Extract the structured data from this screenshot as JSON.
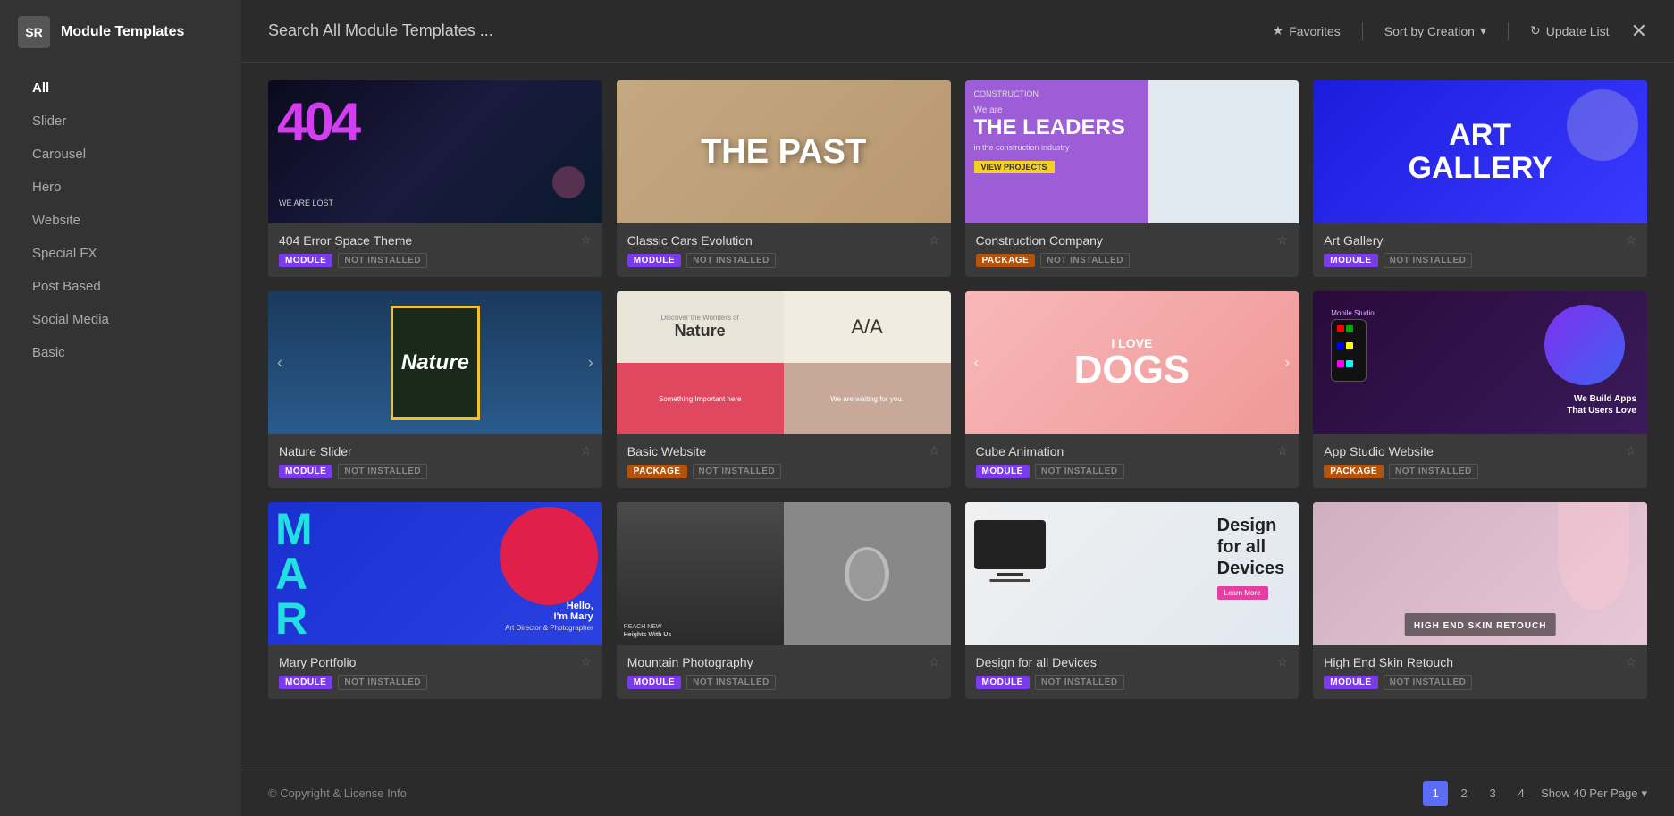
{
  "app": {
    "logo": "SR",
    "sidebar_title": "Module Templates"
  },
  "sidebar": {
    "items": [
      {
        "label": "All",
        "active": true
      },
      {
        "label": "Slider",
        "active": false
      },
      {
        "label": "Carousel",
        "active": false
      },
      {
        "label": "Hero",
        "active": false
      },
      {
        "label": "Website",
        "active": false
      },
      {
        "label": "Special FX",
        "active": false
      },
      {
        "label": "Post Based",
        "active": false
      },
      {
        "label": "Social Media",
        "active": false
      },
      {
        "label": "Basic",
        "active": false
      }
    ]
  },
  "topbar": {
    "search_placeholder": "Search All Module Templates ...",
    "favorites_label": "Favorites",
    "sort_label": "Sort by Creation",
    "update_label": "Update List",
    "close_label": "✕"
  },
  "grid": {
    "cards": [
      {
        "title": "404 Error Space Theme",
        "tag": "MODULE",
        "tag_type": "module",
        "installed": false,
        "installed_label": "NOT INSTALLED"
      },
      {
        "title": "Classic Cars Evolution",
        "tag": "MODULE",
        "tag_type": "module",
        "installed": false,
        "installed_label": "NOT INSTALLED"
      },
      {
        "title": "Construction Company",
        "tag": "PACKAGE",
        "tag_type": "package",
        "installed": false,
        "installed_label": "NOT INSTALLED"
      },
      {
        "title": "Art Gallery",
        "tag": "MODULE",
        "tag_type": "module",
        "installed": false,
        "installed_label": "NOT INSTALLED"
      },
      {
        "title": "Nature Slider",
        "tag": "MODULE",
        "tag_type": "module",
        "installed": false,
        "installed_label": "NOT INSTALLED"
      },
      {
        "title": "Basic Website",
        "tag": "PACKAGE",
        "tag_type": "package",
        "installed": false,
        "installed_label": "NOT INSTALLED"
      },
      {
        "title": "Cube Animation",
        "tag": "MODULE",
        "tag_type": "module",
        "installed": false,
        "installed_label": "NOT INSTALLED"
      },
      {
        "title": "App Studio Website",
        "tag": "PACKAGE",
        "tag_type": "package",
        "installed": false,
        "installed_label": "NOT INSTALLED"
      },
      {
        "title": "Mary Portfolio",
        "tag": "MODULE",
        "tag_type": "module",
        "installed": false,
        "installed_label": "NOT INSTALLED"
      },
      {
        "title": "Mountain Photography",
        "tag": "MODULE",
        "tag_type": "module",
        "installed": false,
        "installed_label": "NOT INSTALLED"
      },
      {
        "title": "Design for all Devices",
        "tag": "MODULE",
        "tag_type": "module",
        "installed": false,
        "installed_label": "NOT INSTALLED"
      },
      {
        "title": "High End Skin Retouch",
        "tag": "MODULE",
        "tag_type": "module",
        "installed": false,
        "installed_label": "NOT INSTALLED"
      }
    ]
  },
  "footer": {
    "copyright": "© Copyright & License Info",
    "pagination": [
      "1",
      "2",
      "3",
      "4"
    ],
    "per_page_label": "Show 40 Per Page"
  }
}
